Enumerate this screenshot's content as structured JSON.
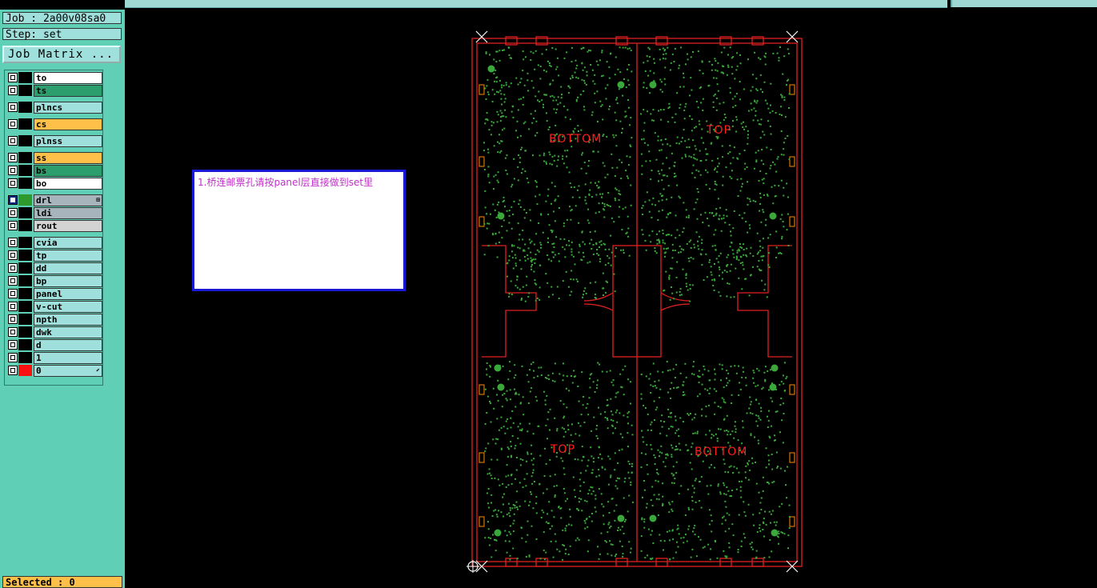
{
  "job": {
    "job_label": "Job : 2a00v08sa0",
    "step_label": "Step: set",
    "matrix_button": "Job Matrix ..."
  },
  "layers": [
    {
      "name": "to",
      "color": "white"
    },
    {
      "name": "ts",
      "color": "green"
    },
    {
      "name": "plncs",
      "color": "plain"
    },
    {
      "name": "cs",
      "color": "orange"
    },
    {
      "name": "plnss",
      "color": "plain"
    },
    {
      "name": "ss",
      "color": "orange"
    },
    {
      "name": "bs",
      "color": "green"
    },
    {
      "name": "bo",
      "color": "white"
    },
    {
      "name": "drl",
      "color": "grey",
      "selected": true,
      "swatch": "#2e9a2e",
      "mark": "⊞"
    },
    {
      "name": "ldi",
      "color": "grey"
    },
    {
      "name": "rout",
      "color": "lgrey"
    },
    {
      "name": "cvia",
      "color": "plain"
    },
    {
      "name": "tp",
      "color": "plain"
    },
    {
      "name": "dd",
      "color": "plain"
    },
    {
      "name": "bp",
      "color": "plain"
    },
    {
      "name": "panel",
      "color": "plain"
    },
    {
      "name": "v-cut",
      "color": "plain"
    },
    {
      "name": "npth",
      "color": "plain"
    },
    {
      "name": "dwk",
      "color": "plain"
    },
    {
      "name": "d",
      "color": "plain"
    },
    {
      "name": "1",
      "color": "plain"
    },
    {
      "name": "0",
      "color": "plain",
      "swatch": "#ff1010",
      "mark": "⬋"
    }
  ],
  "status": {
    "selected_label": "Selected : 0"
  },
  "note": {
    "text": "1.桥连邮票孔请按panel层直接做到set里"
  },
  "board": {
    "labels": [
      "BOTTOM",
      "TOP",
      "TOP",
      "BOTTOM"
    ],
    "outline_color": "#e02020",
    "pad_color": "#3aa83a",
    "text_color": "#ff2020"
  }
}
